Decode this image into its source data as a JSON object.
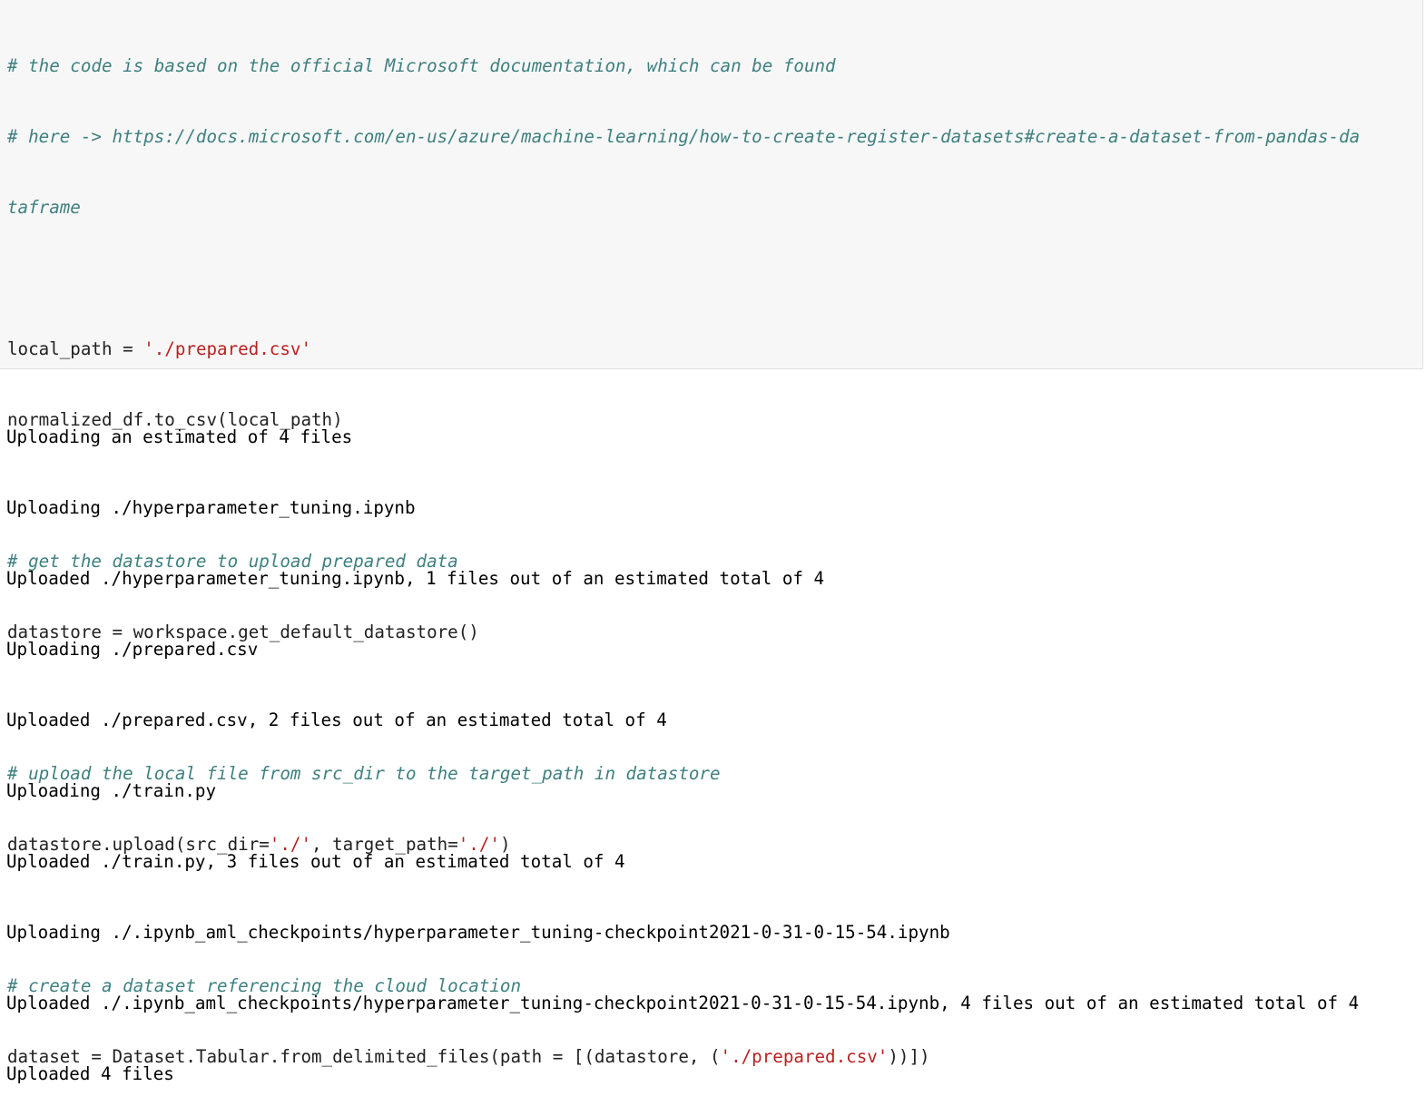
{
  "code_cell": {
    "line1": "# the code is based on the official Microsoft documentation, which can be found",
    "line2": "# here -> https://docs.microsoft.com/en-us/azure/machine-learning/how-to-create-register-datasets#create-a-dataset-from-pandas-da",
    "line3": "taframe",
    "line4": "",
    "line5_pre": "local_path = ",
    "line5_str": "'./prepared.csv'",
    "line6": "normalized_df.to_csv(local_path)",
    "line7": "",
    "line8": "# get the datastore to upload prepared data",
    "line9": "datastore = workspace.get_default_datastore()",
    "line10": "",
    "line11": "# upload the local file from src_dir to the target_path in datastore",
    "line12_a": "datastore.upload(src_dir=",
    "line12_s1": "'./'",
    "line12_b": ", target_path=",
    "line12_s2": "'./'",
    "line12_c": ")",
    "line13": "",
    "line14": "# create a dataset referencing the cloud location",
    "line15_a": "dataset = Dataset.Tabular.from_delimited_files(path = [(datastore, (",
    "line15_s": "'./prepared.csv'",
    "line15_b": "))])"
  },
  "output": [
    "Uploading an estimated of 4 files",
    "Uploading ./hyperparameter_tuning.ipynb",
    "Uploaded ./hyperparameter_tuning.ipynb, 1 files out of an estimated total of 4",
    "Uploading ./prepared.csv",
    "Uploaded ./prepared.csv, 2 files out of an estimated total of 4",
    "Uploading ./train.py",
    "Uploaded ./train.py, 3 files out of an estimated total of 4",
    "Uploading ./.ipynb_aml_checkpoints/hyperparameter_tuning-checkpoint2021-0-31-0-15-54.ipynb",
    "Uploaded ./.ipynb_aml_checkpoints/hyperparameter_tuning-checkpoint2021-0-31-0-15-54.ipynb, 4 files out of an estimated total of 4",
    "Uploaded 4 files"
  ],
  "colors": {
    "comment": "#408080",
    "string": "#ba2121",
    "code_text": "#212121",
    "cell_background": "#f7f7f7",
    "output_text": "#000000"
  }
}
